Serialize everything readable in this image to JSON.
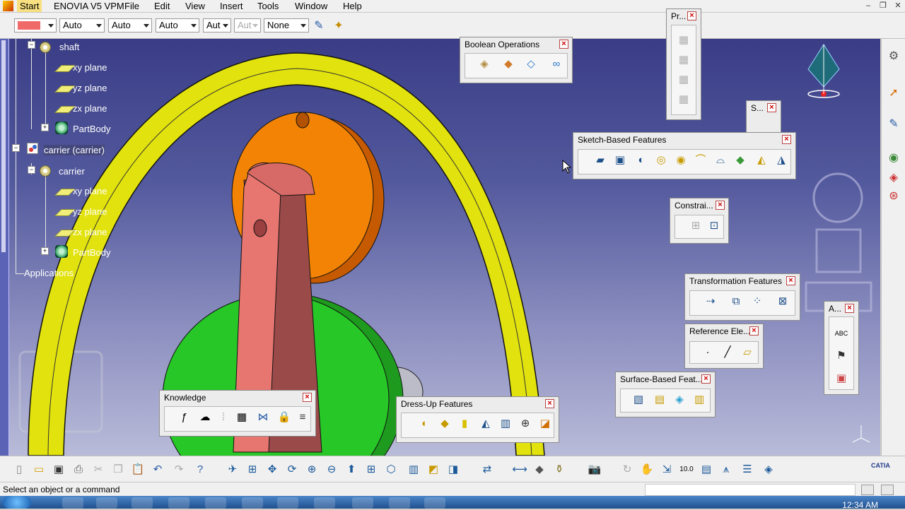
{
  "menubar": {
    "items": [
      "Start",
      "ENOVIA V5 VPM",
      "File",
      "Edit",
      "View",
      "Insert",
      "Tools",
      "Window",
      "Help"
    ],
    "active": "Start"
  },
  "window_controls": [
    "–",
    "❐",
    "✕"
  ],
  "propbar": {
    "color_swatch": "#f06a6a",
    "combos": [
      "Auto",
      "Auto",
      "Auto",
      "Aut",
      "Aut",
      "None"
    ],
    "disabled_combo_index": 4
  },
  "tree": {
    "shaft": "shaft",
    "shaft_planes": [
      "xy plane",
      "yz plane",
      "zx plane"
    ],
    "shaft_body": "PartBody",
    "carrier_product": "carrier (carrier)",
    "carrier": "carrier",
    "carrier_planes": [
      "xy plane",
      "yz plane",
      "zx plane"
    ],
    "carrier_body": "PartBody",
    "applications": "Applications"
  },
  "toolbars": {
    "boolean": {
      "title": "Boolean Operations",
      "icons": [
        "assemble-icon",
        "add-icon",
        "remove-icon",
        "union-trim-icon"
      ]
    },
    "sketch": {
      "title": "Sketch-Based Features",
      "icons": [
        "pad-icon",
        "pocket-icon",
        "shaft-icon",
        "groove-icon",
        "hole-icon",
        "rib-icon",
        "slot-icon",
        "stiffener-icon",
        "multi-section-solid-icon",
        "removed-multi-section-icon"
      ]
    },
    "constraint": {
      "title": "Constrai...",
      "icons": [
        "constraint-icon",
        "constraint-defined-icon"
      ]
    },
    "transformation": {
      "title": "Transformation Features",
      "icons": [
        "translation-icon",
        "mirror-icon",
        "rectangular-pattern-icon",
        "scaling-icon"
      ]
    },
    "reference": {
      "title": "Reference Ele...",
      "icons": [
        "point-icon",
        "line-icon",
        "plane-icon"
      ]
    },
    "surface": {
      "title": "Surface-Based Feat...",
      "icons": [
        "split-icon",
        "thick-surface-icon",
        "close-surface-icon",
        "sew-surface-icon"
      ]
    },
    "knowledge": {
      "title": "Knowledge",
      "icons": [
        "formula-icon",
        "comment-icon",
        "design-table-icon",
        "table-icon",
        "law-icon",
        "lock-icon",
        "rules-icon"
      ]
    },
    "dressup": {
      "title": "Dress-Up Features",
      "icons": [
        "fillet-icon",
        "chamfer-icon",
        "draft-icon",
        "shell-icon",
        "thickness-icon",
        "thread-icon",
        "remove-face-icon"
      ]
    },
    "product": {
      "title": "Pr...",
      "icons": [
        "product-icon-1",
        "product-icon-2",
        "product-icon-3",
        "product-icon-4"
      ]
    },
    "small": {
      "title": "S..."
    },
    "annotation": {
      "title": "A...",
      "icons": [
        "text-abc-icon",
        "flag-note-icon",
        "annotation-view-icon"
      ]
    }
  },
  "bottombar": {
    "icons": [
      "new-icon",
      "open-icon",
      "save-icon",
      "print-icon",
      "cut-icon",
      "copy-icon",
      "paste-icon",
      "undo-icon",
      "redo-icon",
      "help-icon",
      "fly-mode-icon",
      "fit-all-icon",
      "pan-icon",
      "rotate-icon",
      "zoom-in-icon",
      "zoom-out-icon",
      "normal-view-icon",
      "multi-view-icon",
      "iso-view-icon",
      "shading-icon",
      "hide-show-icon",
      "swap-space-icon",
      "measure-icon",
      "measure-inertia-icon",
      "apply-material-icon",
      "capture-icon",
      "update-icon",
      "manipulate-icon",
      "snap-icon",
      "grid-icon",
      "parameters-icon",
      "catalog-icon",
      "sheet-icon"
    ],
    "catia_logo": "CATIA"
  },
  "righttb": {
    "icons": [
      "settings-icon",
      "select-icon",
      "sketcher-icon",
      "part-design-icon",
      "product-icon",
      "fasten-icon"
    ]
  },
  "status": {
    "text": "Select an object or a command"
  },
  "taskbar": {
    "clock": "12:34 AM"
  }
}
